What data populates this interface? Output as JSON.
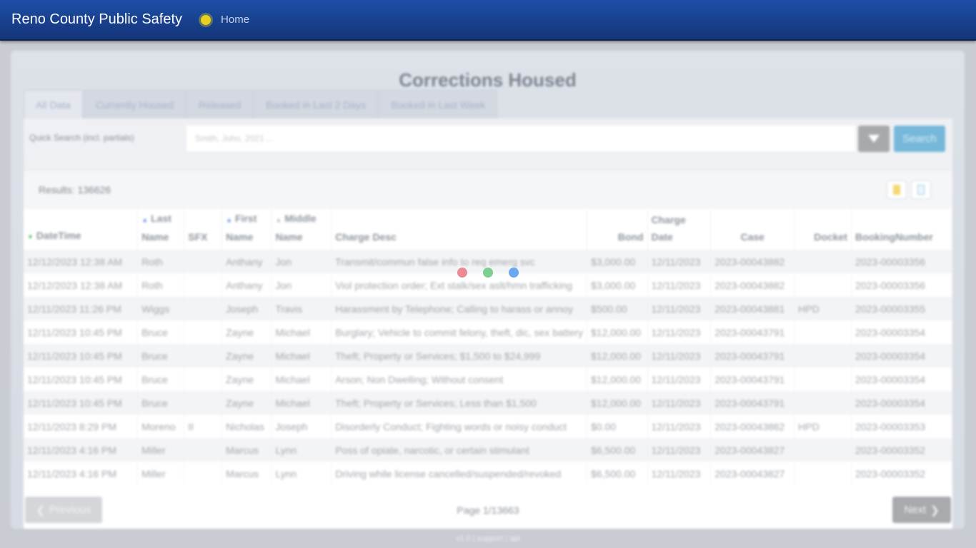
{
  "navbar": {
    "brand": "Reno County Public Safety",
    "home_label": "Home"
  },
  "page": {
    "title": "Corrections Housed"
  },
  "tabs": [
    {
      "label": "All Data"
    },
    {
      "label": "Currently Housed"
    },
    {
      "label": "Released"
    },
    {
      "label": "Booked in Last 2 Days"
    },
    {
      "label": "Booked in Last Week"
    }
  ],
  "search": {
    "label": "Quick Search (incl. partials)",
    "placeholder": "Smith, John, 2021 ...",
    "button_label": "Search"
  },
  "results": {
    "label": "Results: 136626"
  },
  "table": {
    "columns": [
      {
        "label": "DateTime",
        "sort": "down"
      },
      {
        "label": "Last Name",
        "sort": "up"
      },
      {
        "label": "SFX",
        "sort": ""
      },
      {
        "label": "First Name",
        "sort": "up"
      },
      {
        "label": "Middle Name",
        "sort": "gray"
      },
      {
        "label": "Charge Desc",
        "sort": ""
      },
      {
        "label": "Bond",
        "sort": ""
      },
      {
        "label": "Charge Date",
        "sort": ""
      },
      {
        "label": "Case",
        "sort": ""
      },
      {
        "label": "Docket",
        "sort": ""
      },
      {
        "label": "BookingNumber",
        "sort": ""
      }
    ],
    "rows": [
      [
        "12/12/2023 12:38 AM",
        "Roth",
        "",
        "Anthany",
        "Jon",
        "Transmit/commun false info to req emerg svc",
        "$3,000.00",
        "12/11/2023",
        "2023-00043882",
        "",
        "2023-00003356"
      ],
      [
        "12/12/2023 12:38 AM",
        "Roth",
        "",
        "Anthany",
        "Jon",
        "Viol protection order; Ext stalk/sex aslt/hmn trafficking",
        "$3,000.00",
        "12/11/2023",
        "2023-00043882",
        "",
        "2023-00003356"
      ],
      [
        "12/11/2023 11:26 PM",
        "Wiggs",
        "",
        "Joseph",
        "Travis",
        "Harassment by Telephone; Calling to harass or annoy",
        "$500.00",
        "12/11/2023",
        "2023-00043881",
        "HPD",
        "2023-00003355"
      ],
      [
        "12/11/2023 10:45 PM",
        "Bruce",
        "",
        "Zayne",
        "Michael",
        "Burglary; Vehicle to commit felony, theft, dic, sex battery",
        "$12,000.00",
        "12/11/2023",
        "2023-00043791",
        "",
        "2023-00003354"
      ],
      [
        "12/11/2023 10:45 PM",
        "Bruce",
        "",
        "Zayne",
        "Michael",
        "Theft; Property or Services; $1,500 to $24,999",
        "$12,000.00",
        "12/11/2023",
        "2023-00043791",
        "",
        "2023-00003354"
      ],
      [
        "12/11/2023 10:45 PM",
        "Bruce",
        "",
        "Zayne",
        "Michael",
        "Arson; Non Dwelling; Without consent",
        "$12,000.00",
        "12/11/2023",
        "2023-00043791",
        "",
        "2023-00003354"
      ],
      [
        "12/11/2023 10:45 PM",
        "Bruce",
        "",
        "Zayne",
        "Michael",
        "Theft; Property or Services; Less than $1,500",
        "$12,000.00",
        "12/11/2023",
        "2023-00043791",
        "",
        "2023-00003354"
      ],
      [
        "12/11/2023 8:29 PM",
        "Moreno",
        "II",
        "Nicholas",
        "Joseph",
        "Disorderly Conduct; Fighting words or noisy conduct",
        "$0.00",
        "12/11/2023",
        "2023-00043862",
        "HPD",
        "2023-00003353"
      ],
      [
        "12/11/2023 4:16 PM",
        "Miller",
        "",
        "Marcus",
        "Lynn",
        "Poss of opiate, narcotic, or certain stimulant",
        "$6,500.00",
        "12/11/2023",
        "2023-00043827",
        "",
        "2023-00003352"
      ],
      [
        "12/11/2023 4:16 PM",
        "Miller",
        "",
        "Marcus",
        "Lynn",
        "Driving while license cancelled/suspended/revoked",
        "$6,500.00",
        "12/11/2023",
        "2023-00043827",
        "",
        "2023-00003352"
      ]
    ]
  },
  "pager": {
    "prev_label": "Previous",
    "next_label": "Next",
    "page_info": "Page 1/13663"
  },
  "footer": {
    "text": "v1.0 | support | api"
  },
  "loader": {
    "colors": [
      "#e98a94",
      "#7ccf8e",
      "#6aa8f2"
    ]
  },
  "icons": {
    "home": "sun-icon",
    "filter": "funnel-icon",
    "excel": "excel-icon",
    "doc": "document-icon"
  }
}
